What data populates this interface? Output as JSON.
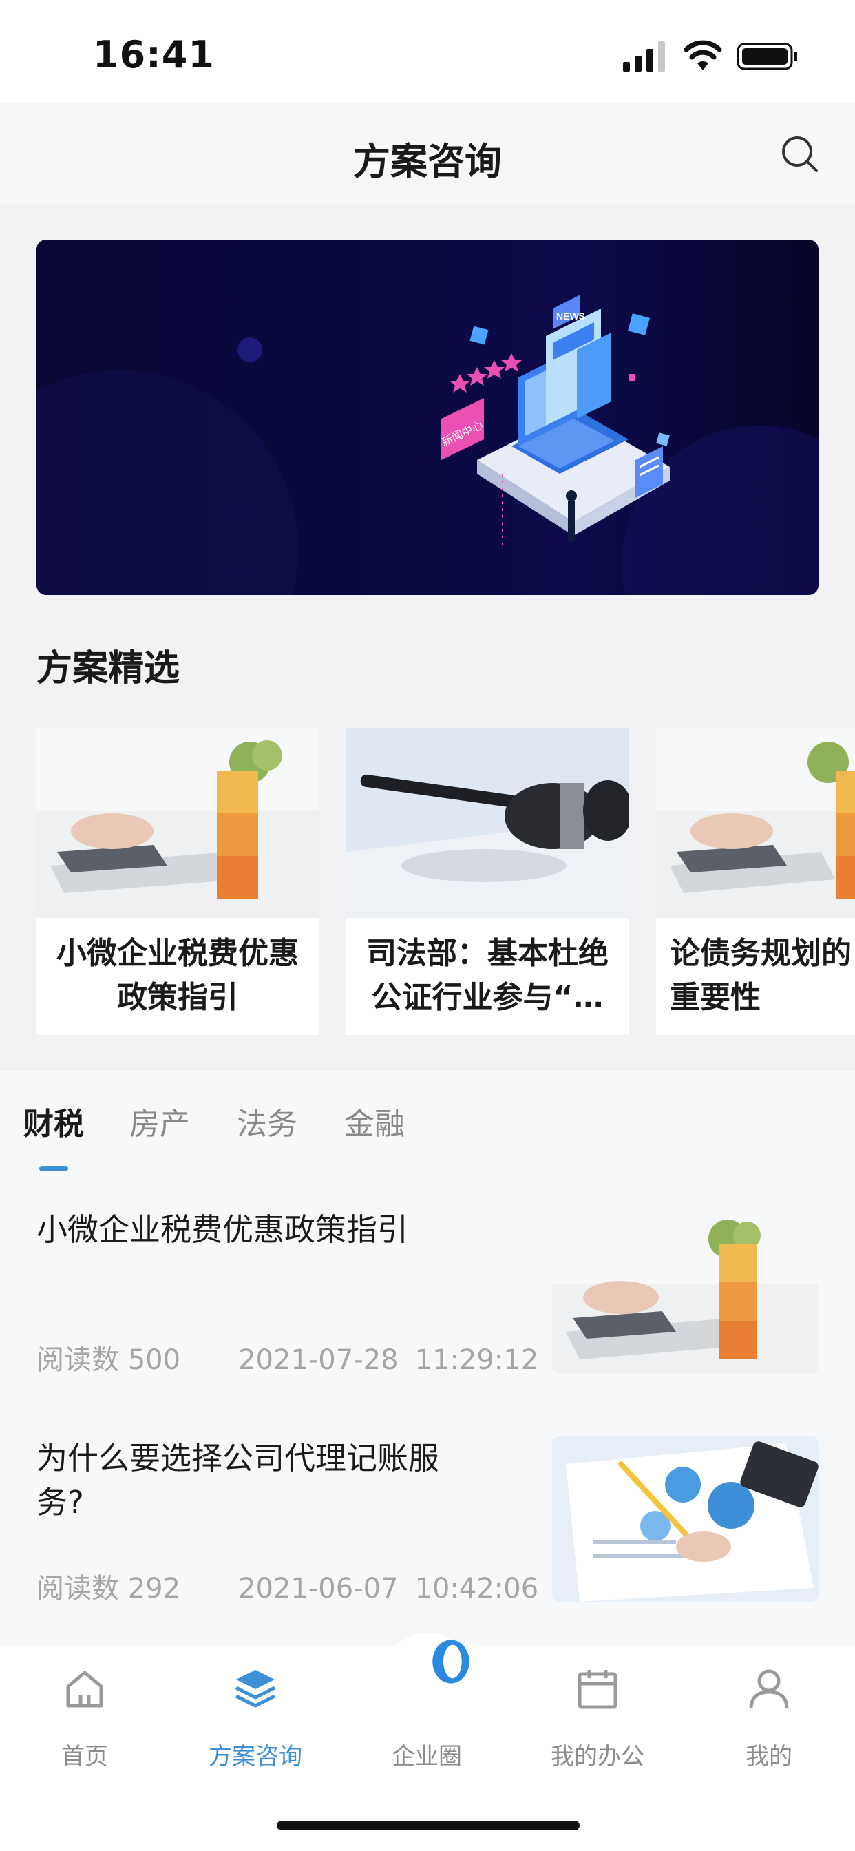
{
  "status_bar": {
    "time": "16:41"
  },
  "header": {
    "title": "方案咨询"
  },
  "featured": {
    "section_title": "方案精选",
    "cards": [
      {
        "title": "小微企业税费优惠政策指引"
      },
      {
        "title": "司法部：基本杜绝公证行业参与“…"
      },
      {
        "title": "论债务规划的重要性"
      }
    ]
  },
  "banner": {
    "sign_text": "新闻中心",
    "news_badge": "NEWS"
  },
  "tabs": [
    {
      "label": "财税",
      "active": true
    },
    {
      "label": "房产",
      "active": false
    },
    {
      "label": "法务",
      "active": false
    },
    {
      "label": "金融",
      "active": false
    }
  ],
  "articles": [
    {
      "title": "小微企业税费优惠政策指引",
      "reads_label": "阅读数 500",
      "date": "2021-07-28",
      "time": "11:29:12"
    },
    {
      "title": "为什么要选择公司代理记账服务?",
      "reads_label": "阅读数 292",
      "date": "2021-06-07",
      "time": "10:42:06"
    }
  ],
  "tab_bar": {
    "items": [
      {
        "label": "首页",
        "icon": "home-icon"
      },
      {
        "label": "方案咨询",
        "icon": "layers-icon",
        "active": true
      },
      {
        "label": "企业圈",
        "icon": "circle-logo-icon"
      },
      {
        "label": "我的办公",
        "icon": "calendar-icon"
      },
      {
        "label": "我的",
        "icon": "user-icon"
      }
    ]
  },
  "colors": {
    "accent": "#3d8fd6",
    "banner_bg": "#0b0836",
    "muted_text": "#a5a5a5"
  }
}
